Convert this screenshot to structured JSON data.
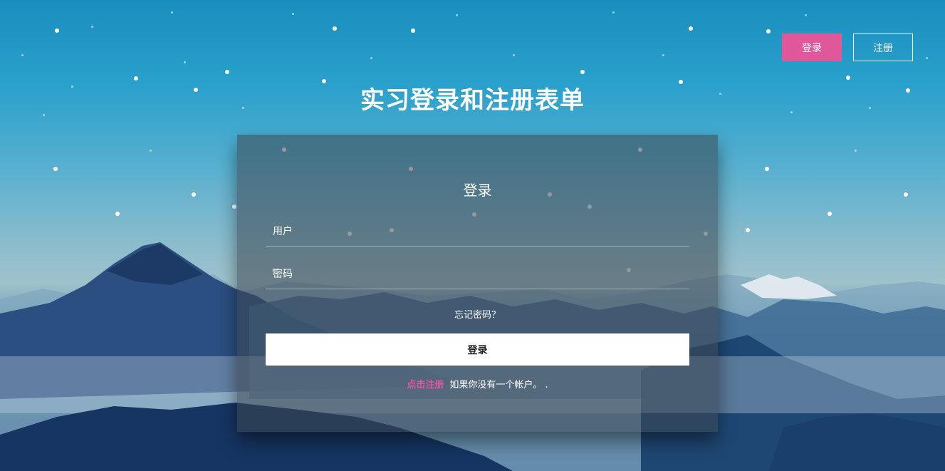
{
  "nav": {
    "login_label": "登录",
    "register_label": "注册"
  },
  "page": {
    "title": "实习登录和注册表单"
  },
  "form": {
    "title": "登录",
    "username_placeholder": "用户",
    "password_placeholder": "密码",
    "forgot_label": "忘记密码？",
    "submit_label": "登录",
    "signup_link": "点击注册",
    "signup_text": "如果你没有一个帐户。 ."
  },
  "colors": {
    "accent_pink": "#e0579b",
    "sky_top": "#1a8fbf",
    "mountain_dark": "#274e7c"
  }
}
